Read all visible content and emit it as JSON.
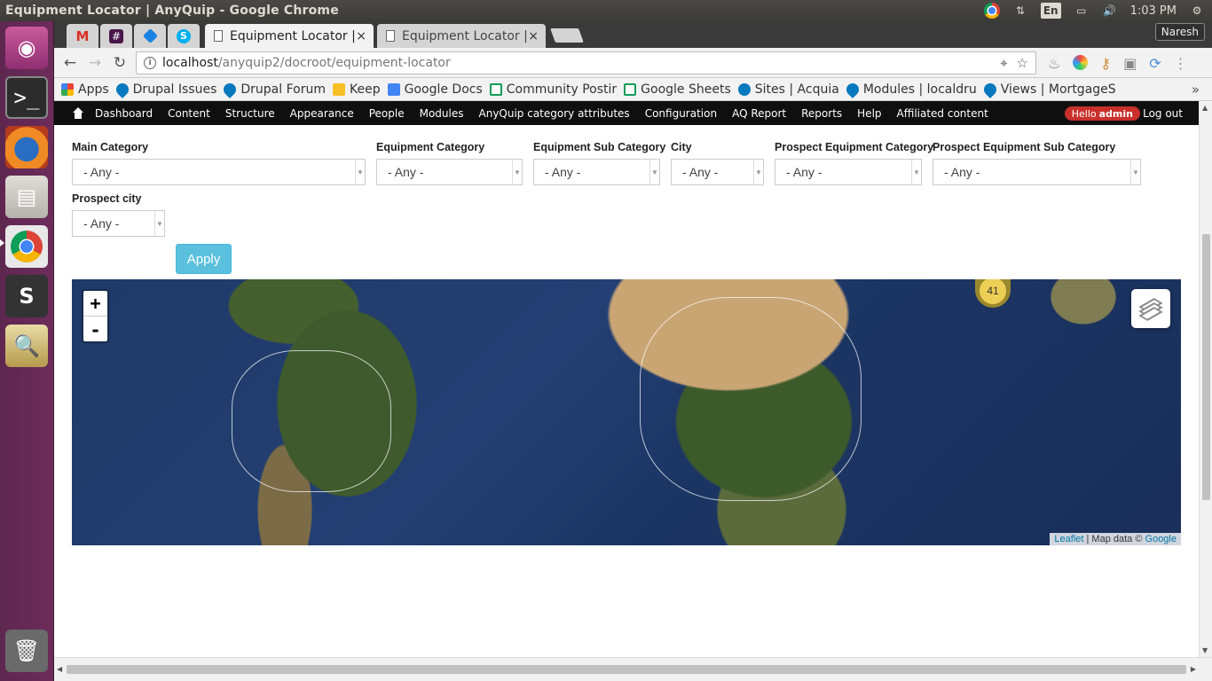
{
  "os": {
    "window_title": "Equipment Locator | AnyQuip - Google Chrome",
    "language": "En",
    "time": "1:03 PM",
    "user": "Naresh",
    "launcher": [
      "ubuntu-dash",
      "terminal",
      "firefox",
      "files",
      "chrome",
      "sublime-text",
      "image-viewer",
      "trash"
    ]
  },
  "browser": {
    "tabs": [
      {
        "label": "",
        "icon": "gmail-icon"
      },
      {
        "label": "",
        "icon": "slack-icon"
      },
      {
        "label": "",
        "icon": "box-icon"
      },
      {
        "label": "",
        "icon": "skype-icon"
      },
      {
        "label": "Equipment Locator |",
        "active": true,
        "close": "×"
      },
      {
        "label": "Equipment Locator |",
        "active": false,
        "close": "×"
      }
    ],
    "url_host": "localhost",
    "url_path": "/anyquip2/docroot/equipment-locator",
    "bookmarks": [
      {
        "label": "Apps",
        "icon": "apps-grid-icon"
      },
      {
        "label": "Drupal Issues",
        "icon": "drupal-icon"
      },
      {
        "label": "Drupal Forum",
        "icon": "drupal-icon"
      },
      {
        "label": "Keep",
        "icon": "keep-icon"
      },
      {
        "label": "Google Docs",
        "icon": "docs-icon"
      },
      {
        "label": "Community Postir",
        "icon": "sheets-icon"
      },
      {
        "label": "Google Sheets",
        "icon": "sheets-icon"
      },
      {
        "label": "Sites | Acquia",
        "icon": "acquia-icon"
      },
      {
        "label": "Modules | localdru",
        "icon": "drupal-icon"
      },
      {
        "label": "Views | MortgageS",
        "icon": "drupal-icon"
      }
    ],
    "more": "»"
  },
  "admin_bar": {
    "items": [
      "Dashboard",
      "Content",
      "Structure",
      "Appearance",
      "People",
      "Modules",
      "AnyQuip category attributes",
      "Configuration",
      "AQ Report",
      "Reports",
      "Help",
      "Affiliated content"
    ],
    "hello": "Hello",
    "username": "admin",
    "logout": "Log out"
  },
  "filters": {
    "main_category": {
      "label": "Main Category",
      "value": "- Any -"
    },
    "equipment_category": {
      "label": "Equipment Category",
      "value": "- Any -"
    },
    "equipment_sub_category": {
      "label": "Equipment Sub Category",
      "value": "- Any -"
    },
    "city": {
      "label": "City",
      "value": "- Any -"
    },
    "prospect_equipment_category": {
      "label": "Prospect Equipment Category",
      "value": "- Any -"
    },
    "prospect_equipment_sub_category": {
      "label": "Prospect Equipment Sub Category",
      "value": "- Any -"
    },
    "prospect_city": {
      "label": "Prospect city",
      "value": "- Any -"
    },
    "apply": "Apply"
  },
  "map": {
    "zoom_in": "+",
    "zoom_out": "-",
    "cluster_count": "41",
    "attribution_leaflet": "Leaflet",
    "attribution_text": " | Map data © ",
    "attribution_google": "Google"
  }
}
